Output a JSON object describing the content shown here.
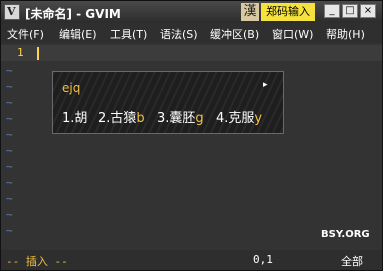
{
  "window": {
    "title": "[未命名] - GVIM",
    "app_icon_glyph": "V",
    "ime_badge": "漢",
    "ime_name": "郑码输入",
    "minimize": "_",
    "maximize": "□",
    "close": "×"
  },
  "menu": [
    "文件(F)",
    "编辑(E)",
    "工具(T)",
    "语法(S)",
    "缓冲区(B)",
    "窗口(W)",
    "帮助(H)"
  ],
  "editor": {
    "line_number": "1",
    "tilde": "~"
  },
  "ime_popup": {
    "input": "ejq",
    "arrow": "▸",
    "candidates": [
      {
        "label": "1.胡",
        "hint": ""
      },
      {
        "label": "2.古猿",
        "hint": "b"
      },
      {
        "label": "3.囊胚",
        "hint": "g"
      },
      {
        "label": "4.克服",
        "hint": "y"
      }
    ]
  },
  "watermark": "BSY.ORG",
  "status": {
    "mode": "-- 插入 --",
    "position": "0,1",
    "scroll": "全部"
  },
  "colors": {
    "accent": "#f0c040",
    "tilde": "#5f78d0",
    "line_number": "#ffd24a"
  }
}
